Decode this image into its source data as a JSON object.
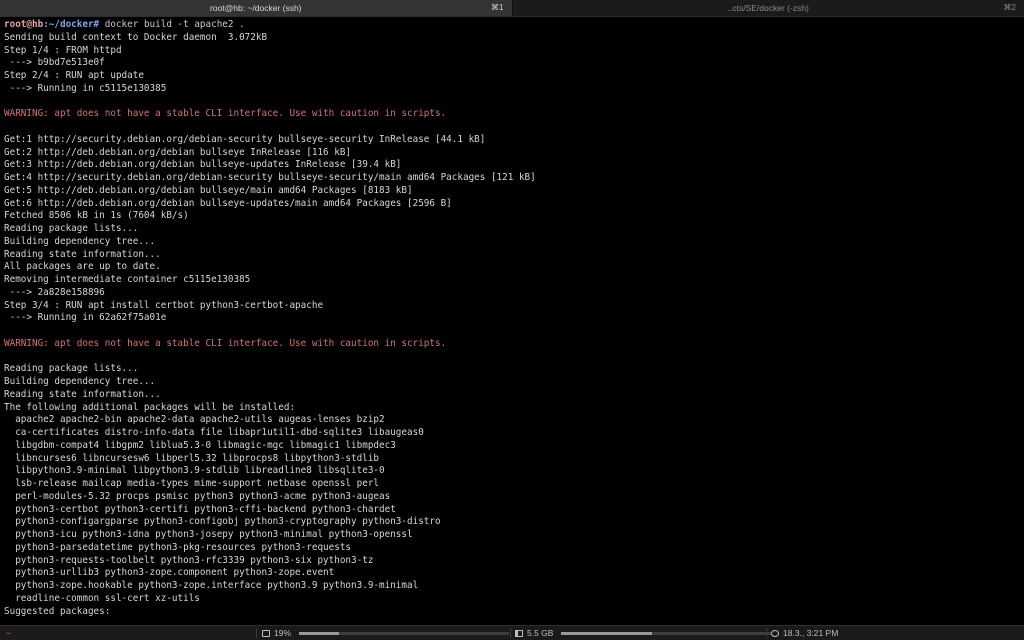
{
  "tabs": [
    {
      "title": "root@hb: ~/docker (ssh)",
      "shortcut": "⌘1",
      "active": true
    },
    {
      "title": "..cts/SE/docker (-zsh)",
      "shortcut": "⌘2",
      "active": false
    }
  ],
  "prompt": {
    "user_host": "root@hb",
    "path": ":~/docker#",
    "command": " docker build -t apache2 ."
  },
  "output": [
    {
      "text": "Sending build context to Docker daemon  3.072kB",
      "type": "normal"
    },
    {
      "text": "Step 1/4 : FROM httpd",
      "type": "normal"
    },
    {
      "text": " ---> b9bd7e513e0f",
      "type": "normal"
    },
    {
      "text": "Step 2/4 : RUN apt update",
      "type": "normal"
    },
    {
      "text": " ---> Running in c5115e130385",
      "type": "normal"
    },
    {
      "text": "",
      "type": "normal"
    },
    {
      "text": "WARNING: apt does not have a stable CLI interface. Use with caution in scripts.",
      "type": "warn"
    },
    {
      "text": "",
      "type": "normal"
    },
    {
      "text": "Get:1 http://security.debian.org/debian-security bullseye-security InRelease [44.1 kB]",
      "type": "normal"
    },
    {
      "text": "Get:2 http://deb.debian.org/debian bullseye InRelease [116 kB]",
      "type": "normal"
    },
    {
      "text": "Get:3 http://deb.debian.org/debian bullseye-updates InRelease [39.4 kB]",
      "type": "normal"
    },
    {
      "text": "Get:4 http://security.debian.org/debian-security bullseye-security/main amd64 Packages [121 kB]",
      "type": "normal"
    },
    {
      "text": "Get:5 http://deb.debian.org/debian bullseye/main amd64 Packages [8183 kB]",
      "type": "normal"
    },
    {
      "text": "Get:6 http://deb.debian.org/debian bullseye-updates/main amd64 Packages [2596 B]",
      "type": "normal"
    },
    {
      "text": "Fetched 8506 kB in 1s (7604 kB/s)",
      "type": "normal"
    },
    {
      "text": "Reading package lists...",
      "type": "normal"
    },
    {
      "text": "Building dependency tree...",
      "type": "normal"
    },
    {
      "text": "Reading state information...",
      "type": "normal"
    },
    {
      "text": "All packages are up to date.",
      "type": "normal"
    },
    {
      "text": "Removing intermediate container c5115e130385",
      "type": "normal"
    },
    {
      "text": " ---> 2a828e158896",
      "type": "normal"
    },
    {
      "text": "Step 3/4 : RUN apt install certbot python3-certbot-apache",
      "type": "normal"
    },
    {
      "text": " ---> Running in 62a62f75a01e",
      "type": "normal"
    },
    {
      "text": "",
      "type": "normal"
    },
    {
      "text": "WARNING: apt does not have a stable CLI interface. Use with caution in scripts.",
      "type": "warn"
    },
    {
      "text": "",
      "type": "normal"
    },
    {
      "text": "Reading package lists...",
      "type": "normal"
    },
    {
      "text": "Building dependency tree...",
      "type": "normal"
    },
    {
      "text": "Reading state information...",
      "type": "normal"
    },
    {
      "text": "The following additional packages will be installed:",
      "type": "normal"
    },
    {
      "text": "  apache2 apache2-bin apache2-data apache2-utils augeas-lenses bzip2",
      "type": "normal"
    },
    {
      "text": "  ca-certificates distro-info-data file libapr1util1-dbd-sqlite3 libaugeas0",
      "type": "normal"
    },
    {
      "text": "  libgdbm-compat4 libgpm2 liblua5.3-0 libmagic-mgc libmagic1 libmpdec3",
      "type": "normal"
    },
    {
      "text": "  libncurses6 libncursesw6 libperl5.32 libprocps8 libpython3-stdlib",
      "type": "normal"
    },
    {
      "text": "  libpython3.9-minimal libpython3.9-stdlib libreadline8 libsqlite3-0",
      "type": "normal"
    },
    {
      "text": "  lsb-release mailcap media-types mime-support netbase openssl perl",
      "type": "normal"
    },
    {
      "text": "  perl-modules-5.32 procps psmisc python3 python3-acme python3-augeas",
      "type": "normal"
    },
    {
      "text": "  python3-certbot python3-certifi python3-cffi-backend python3-chardet",
      "type": "normal"
    },
    {
      "text": "  python3-configargparse python3-configobj python3-cryptography python3-distro",
      "type": "normal"
    },
    {
      "text": "  python3-icu python3-idna python3-josepy python3-minimal python3-openssl",
      "type": "normal"
    },
    {
      "text": "  python3-parsedatetime python3-pkg-resources python3-requests",
      "type": "normal"
    },
    {
      "text": "  python3-requests-toolbelt python3-rfc3339 python3-six python3-tz",
      "type": "normal"
    },
    {
      "text": "  python3-urllib3 python3-zope.component python3-zope.event",
      "type": "normal"
    },
    {
      "text": "  python3-zope.hookable python3-zope.interface python3.9 python3.9-minimal",
      "type": "normal"
    },
    {
      "text": "  readline-common ssl-cert xz-utils",
      "type": "normal"
    },
    {
      "text": "Suggested packages:",
      "type": "normal"
    }
  ],
  "statusbar": {
    "directory": "~",
    "cpu": "19%",
    "cpu_fraction": 0.19,
    "memory": "5.5 GB",
    "memory_fraction": 0.43,
    "datetime": "18.3., 3:21 PM"
  },
  "colors": {
    "warning": "#e06c6c",
    "prompt_user": "#e8a3a3",
    "prompt_path": "#7fa7e8"
  }
}
